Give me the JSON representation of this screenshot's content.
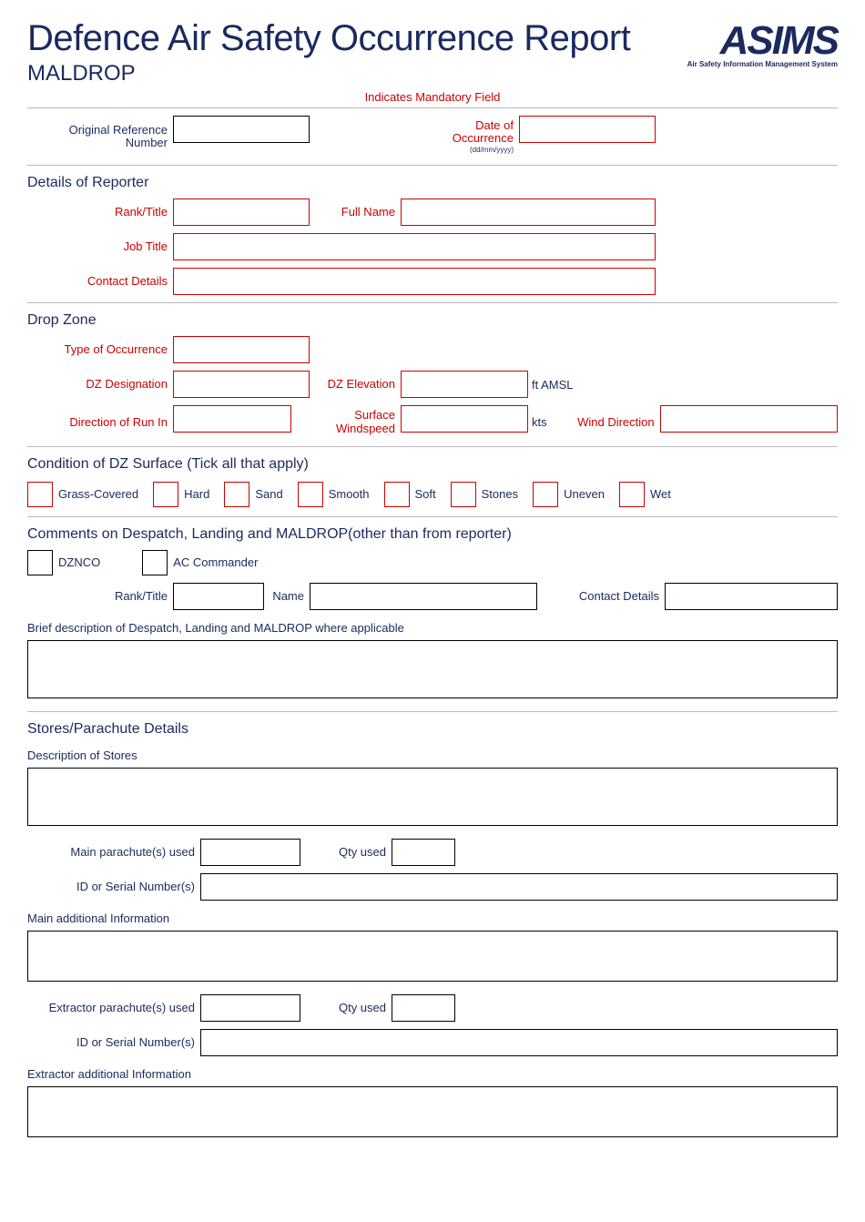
{
  "header": {
    "title": "Defence Air Safety Occurrence Report",
    "subtitle": "MALDROP",
    "logo_text": "ASIMS",
    "logo_tag": "Air Safety Information Management System",
    "mandatory": "Indicates Mandatory Field"
  },
  "fields": {
    "ref_label": "Original Reference Number",
    "date_label": "Date of Occurrence",
    "date_hint": "(dd/mm/yyyy)"
  },
  "sections": {
    "reporter": "Details of Reporter",
    "dz": "Drop Zone",
    "surface": "Condition of DZ Surface (Tick all that apply)",
    "comments": "Comments on Despatch, Landing and MALDROP(other than from reporter)",
    "stores": "Stores/Parachute Details"
  },
  "reporter": {
    "rank": "Rank/Title",
    "name": "Full Name",
    "job": "Job Title",
    "contact": "Contact Details"
  },
  "dz": {
    "type": "Type of Occurrence",
    "designation": "DZ Designation",
    "elevation": "DZ Elevation",
    "elevation_unit": "ft AMSL",
    "runin": "Direction of Run In",
    "wind": "Surface Windspeed",
    "wind_unit": "kts",
    "winddir": "Wind Direction"
  },
  "surface_opts": [
    "Grass-Covered",
    "Hard",
    "Sand",
    "Smooth",
    "Soft",
    "Stones",
    "Uneven",
    "Wet"
  ],
  "comments": {
    "dznco": "DZNCO",
    "ac": "AC Commander",
    "rank": "Rank/Title",
    "name": "Name",
    "contact": "Contact Details",
    "brief": "Brief description of Despatch, Landing and MALDROP where applicable"
  },
  "stores": {
    "desc": "Description of Stores",
    "main": "Main parachute(s) used",
    "qty": "Qty used",
    "serial": "ID or Serial Number(s)",
    "main_info": "Main additional Information",
    "ext": "Extractor parachute(s) used",
    "ext_info": "Extractor additional Information"
  }
}
